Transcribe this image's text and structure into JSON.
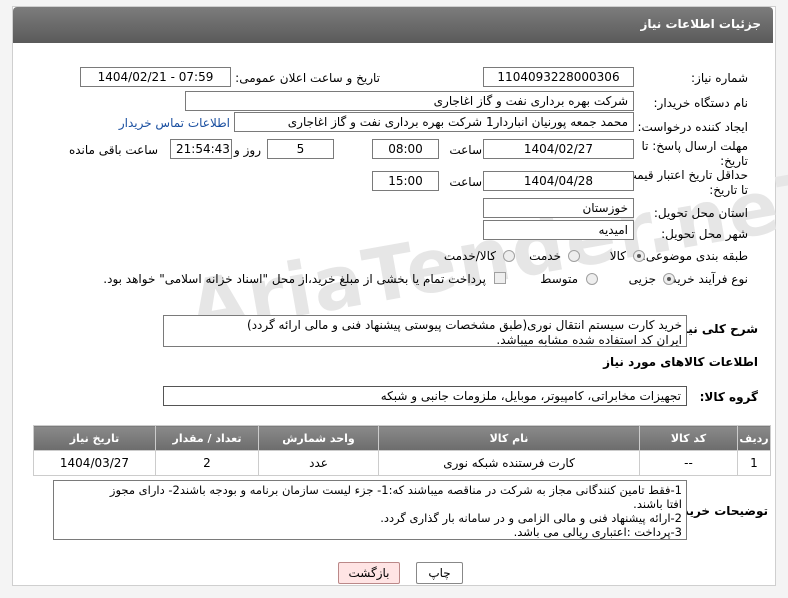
{
  "header": {
    "title": "جزئیات اطلاعات نیاز"
  },
  "watermark": "AriaTender.neT",
  "form": {
    "need_number_label": "شماره نیاز:",
    "need_number": "1104093228000306",
    "announce_label": "تاریخ و ساعت اعلان عمومی:",
    "announce_value": "1404/02/21 - 07:59",
    "buyer_org_label": "نام دستگاه خریدار:",
    "buyer_org": "شرکت بهره برداری نفت و گاز اغاجاری",
    "creator_label": "ایجاد کننده درخواست:",
    "creator": "محمد جمعه پورنیان انباردار1 شرکت بهره برداری نفت و گاز اغاجاری",
    "contact_link": "اطلاعات تماس خریدار",
    "reply_deadline_label": "مهلت ارسال پاسخ: تا تاریخ:",
    "reply_date": "1404/02/27",
    "time_label": "ساعت",
    "reply_time": "08:00",
    "days_value": "5",
    "days_label": "روز و",
    "remaining_time": "21:54:43",
    "remaining_label": "ساعت باقی مانده",
    "price_validity_label": "حداقل تاریخ اعتبار قیمت: تا تاریخ:",
    "price_date": "1404/04/28",
    "price_time": "15:00",
    "province_label": "استان محل تحویل:",
    "province": "خوزستان",
    "city_label": "شهر محل تحویل:",
    "city": "امیدیه",
    "category_label": "طبقه بندی موضوعی:",
    "category_options": [
      "کالا",
      "خدمت",
      "کالا/خدمت"
    ],
    "category_selected": "کالا",
    "process_label": "نوع فرآیند خرید :",
    "process_options": [
      "جزیی",
      "متوسط"
    ],
    "process_selected": "جزیی",
    "treasury_note": "پرداخت تمام یا بخشی از مبلغ خرید،از محل \"اسناد خزانه اسلامی\" خواهد بود."
  },
  "description": {
    "label": "شرح کلی نیاز:",
    "line1": "خرید کارت سیستم انتقال نوری(طبق مشخصات پیوستی پیشنهاد فنی و مالی ارائه گردد)",
    "line2": "ایران کد استفاده شده مشابه میباشد."
  },
  "goods": {
    "section_title": "اطلاعات کالاهای مورد نیاز",
    "group_label": "گروه کالا:",
    "group_value": "تجهیزات مخابراتی، کامپیوتر، موبایل، ملزومات جانبی و شبکه",
    "columns": [
      "ردیف",
      "کد کالا",
      "نام کالا",
      "واحد شمارش",
      "تعداد / مقدار",
      "تاریخ نیاز"
    ],
    "rows": [
      [
        "1",
        "--",
        "کارت فرستنده شبکه نوری",
        "عدد",
        "2",
        "1404/03/27"
      ]
    ]
  },
  "buyer_notes": {
    "label": "توضیحات خریدار:",
    "line1": "1-فقط تامین کنندگانی مجاز به شرکت در مناقصه میباشند که:1- جزء لیست سازمان برنامه و بودجه باشند2- دارای مجوز",
    "line2": "افتا باشند.",
    "line3": "2-ارائه پیشنهاد فنی و مالی الزامی و در سامانه بار گذاری گردد.",
    "line4": "3-پرداخت :اعتباری ریالی  می باشد."
  },
  "buttons": {
    "print": "چاپ",
    "back": "بازگشت"
  }
}
